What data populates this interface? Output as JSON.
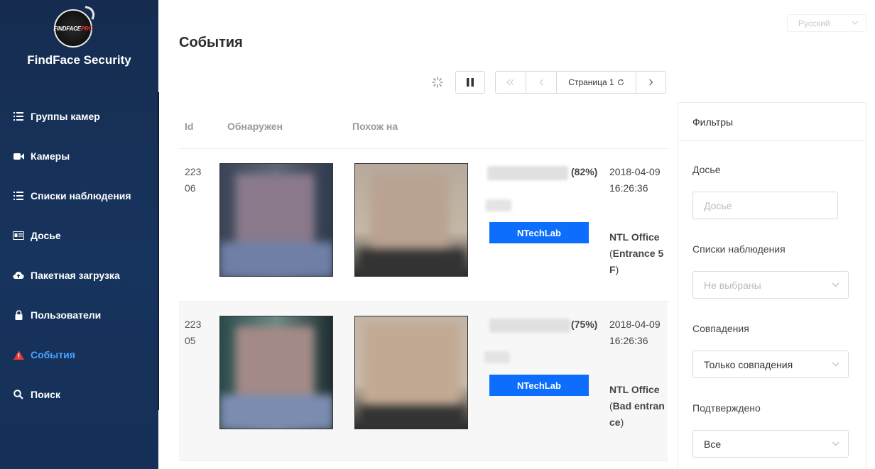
{
  "app": {
    "logo_main": "FINDFACE",
    "logo_sub": "PRO",
    "brand": "FindFace Security"
  },
  "sidebar": {
    "items": [
      {
        "label": "Группы камер",
        "icon": "list-icon"
      },
      {
        "label": "Камеры",
        "icon": "video-camera-icon"
      },
      {
        "label": "Списки наблюдения",
        "icon": "list-icon"
      },
      {
        "label": "Досье",
        "icon": "id-card-icon"
      },
      {
        "label": "Пакетная загрузка",
        "icon": "cloud-upload-icon"
      },
      {
        "label": "Пользователи",
        "icon": "lock-icon"
      },
      {
        "label": "События",
        "icon": "warning-icon",
        "active": true
      },
      {
        "label": "Поиск",
        "icon": "search-icon"
      }
    ]
  },
  "header": {
    "language": "Русский",
    "title": "События"
  },
  "pager": {
    "page_label": "Страница 1"
  },
  "table": {
    "columns": {
      "id": "Id",
      "detected": "Обнаружен",
      "similar": "Похож на"
    },
    "rows": [
      {
        "id": "22306",
        "pct": "(82%)",
        "tag": "NTechLab",
        "date": "2018-04-09",
        "time": "16:26:36",
        "camera_group": "NTL Office",
        "camera": "Entrance 5F"
      },
      {
        "id": "22305",
        "pct": "(75%)",
        "tag": "NTechLab",
        "date": "2018-04-09",
        "time": "16:26:36",
        "camera_group": "NTL Office",
        "camera": "Bad entrance"
      }
    ]
  },
  "filters": {
    "title": "Фильтры",
    "dossier_label": "Досье",
    "dossier_placeholder": "Досье",
    "watchlists_label": "Списки наблюдения",
    "watchlists_value": "Не выбраны",
    "matches_label": "Совпадения",
    "matches_value": "Только совпадения",
    "confirmed_label": "Подтверждено",
    "confirmed_value": "Все"
  },
  "colors": {
    "sidebar_bg": "#17345e",
    "accent": "#0d6efd",
    "active_nav": "#4aa3ff",
    "warning": "#e53935"
  }
}
